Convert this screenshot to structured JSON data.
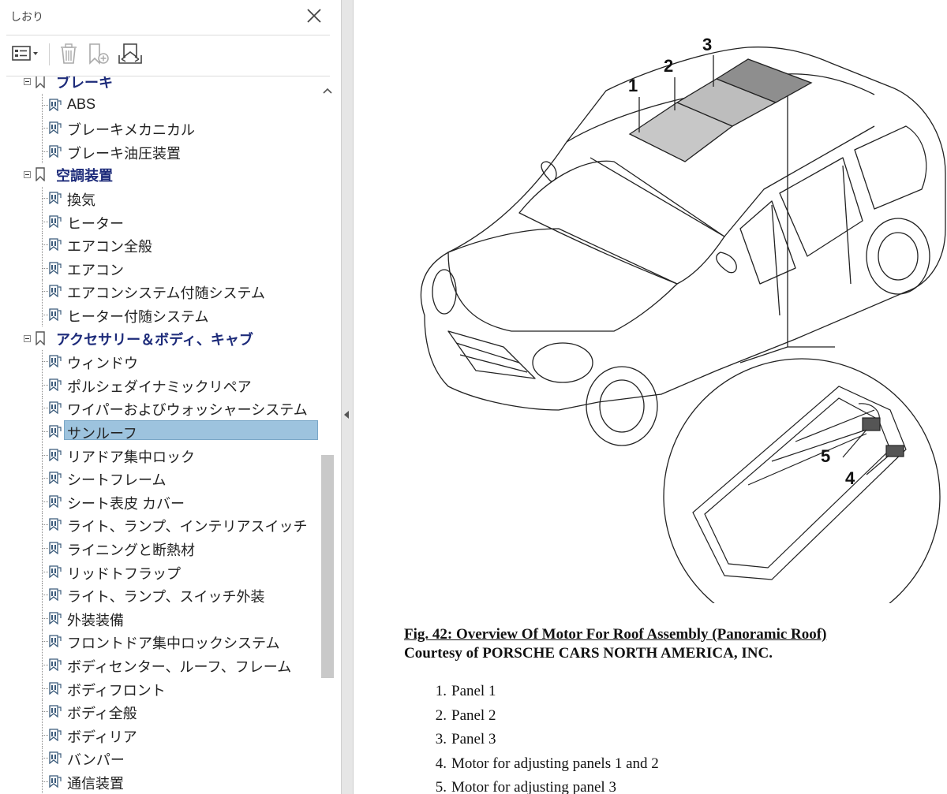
{
  "pane": {
    "title": "しおり",
    "toolbar": {
      "options": "options-icon",
      "delete": "trash-icon",
      "new_bookmark": "new-bookmark-icon",
      "expand": "expand-bookmark-icon"
    }
  },
  "tree": {
    "partial_group": "ブレーキ",
    "items_top": [
      "ABS",
      "ブレーキメカニカル",
      "ブレーキ油圧装置"
    ],
    "group_hvac": "空調装置",
    "items_hvac": [
      "換気",
      "ヒーター",
      "エアコン全般",
      "エアコン",
      "エアコンシステム付随システム",
      "ヒーター付随システム"
    ],
    "group_accessory": "アクセサリー＆ボディ、キャブ",
    "items_accessory": [
      "ウィンドウ",
      "ポルシェダイナミックリペア",
      "ワイパーおよびウォッシャーシステム",
      "サンルーフ",
      "リアドア集中ロック",
      "シートフレーム",
      "シート表皮 カバー",
      "ライト、ランプ、インテリアスイッチ",
      "ライニングと断熱材",
      "リッドトフラップ",
      "ライト、ランプ、スイッチ外装",
      "外装装備",
      "フロントドア集中ロックシステム",
      "ボディセンター、ルーフ、フレーム",
      "ボディフロント",
      "ボディ全般",
      "ボディリア",
      "バンパー",
      "通信装置"
    ],
    "selected": "サンルーフ"
  },
  "document": {
    "callouts": [
      "1",
      "2",
      "3",
      "4",
      "5"
    ],
    "caption": "Fig. 42: Overview Of Motor For Roof Assembly (Panoramic Roof)",
    "courtesy": "Courtesy of PORSCHE CARS NORTH AMERICA, INC.",
    "legend": [
      {
        "num": "1.",
        "text": "Panel 1"
      },
      {
        "num": "2.",
        "text": "Panel 2"
      },
      {
        "num": "3.",
        "text": "Panel 3"
      },
      {
        "num": "4.",
        "text": "Motor for adjusting panels 1 and 2"
      },
      {
        "num": "5.",
        "text": "Motor for adjusting panel 3"
      }
    ]
  },
  "colors": {
    "selection": "#9dc3de",
    "group_text": "#1d2b7a",
    "splitter": "#e6e6e6"
  }
}
